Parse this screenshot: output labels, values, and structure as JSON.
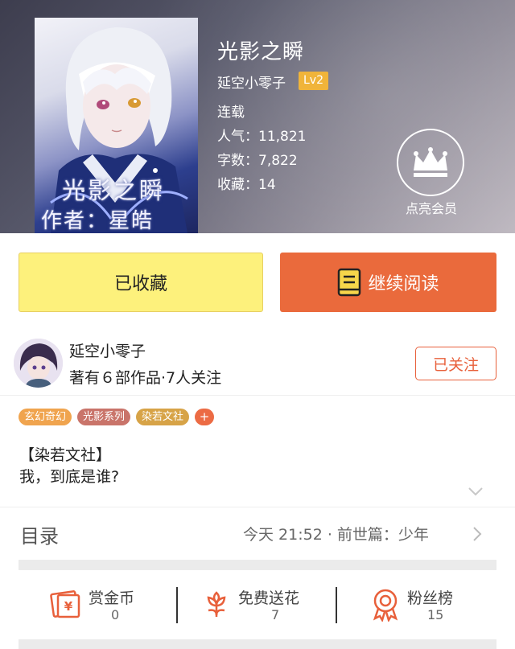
{
  "book": {
    "title": "光影之瞬",
    "author": "延空小零子",
    "level": "Lv2",
    "status": "连载",
    "popularity": "人气：11,821",
    "word_count": "字数：7,822",
    "favorites": "收藏：14",
    "cover_title": "光影之瞬",
    "cover_author": "作者：星皓"
  },
  "vip": {
    "label": "点亮会员",
    "icon": "crown-icon"
  },
  "buttons": {
    "collected": "已收藏",
    "continue_reading": "继续阅读"
  },
  "author_card": {
    "name": "延空小零子",
    "stats": "著有６部作品·7人关注",
    "follow": "已关注"
  },
  "tags": [
    {
      "label": "玄幻奇幻",
      "color": "#f0a44e"
    },
    {
      "label": "光影系列",
      "color": "#c9746a"
    },
    {
      "label": "染若文社",
      "color": "#d7a347"
    }
  ],
  "tag_more": "+",
  "description": {
    "line1": "【染若文社】",
    "line2": "我，到底是谁?"
  },
  "catalog": {
    "label": "目录",
    "latest": "今天 21:52 · 前世篇：少年"
  },
  "actions": [
    {
      "label": "赏金币",
      "value": "0",
      "icon": "reward-coin-icon"
    },
    {
      "label": "免费送花",
      "value": "7",
      "icon": "flower-icon"
    },
    {
      "label": "粉丝榜",
      "value": "15",
      "icon": "medal-icon"
    }
  ],
  "colors": {
    "accent": "#ea6a3c",
    "collected_bg": "#fdf17c",
    "level_badge": "#f0b43a"
  }
}
